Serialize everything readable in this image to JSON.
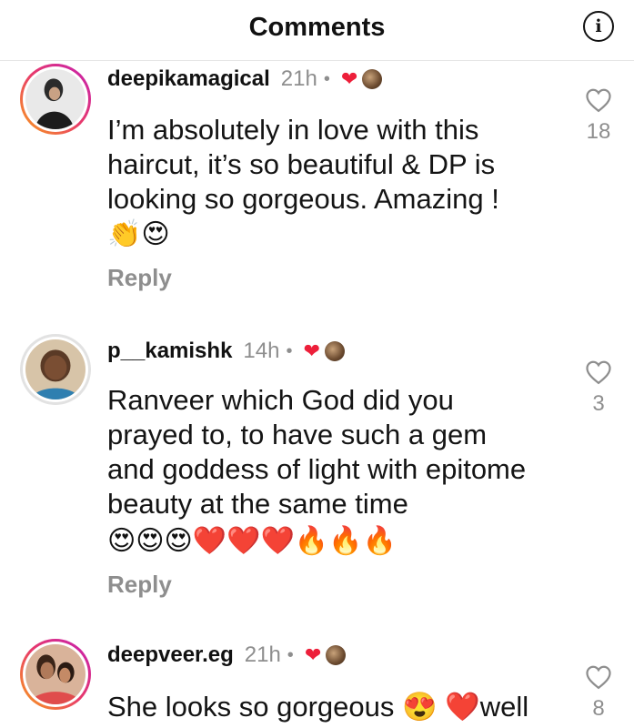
{
  "header": {
    "title": "Comments",
    "info_icon": "i"
  },
  "comments": [
    {
      "username": "deepikamagical",
      "time": "21h",
      "dot": "•",
      "liked_by_author": "❤",
      "text": "I’m absolutely in love with this haircut, it’s so beautiful & DP is looking so gorgeous. Amazing !",
      "emojis": "👏😍",
      "reply_label": "Reply",
      "likes": "18"
    },
    {
      "username": "p__kamishk",
      "time": "14h",
      "dot": "•",
      "liked_by_author": "❤",
      "text": "Ranveer which God did you prayed to, to have such a gem and goddess of light with epitome beauty at the same time",
      "emojis": "😍😍😍❤️❤️❤️🔥🔥🔥",
      "reply_label": "Reply",
      "likes": "3"
    },
    {
      "username": "deepveer.eg",
      "time": "21h",
      "dot": "•",
      "liked_by_author": "❤",
      "text": "She looks so gorgeous 😍 ❤️well",
      "likes": "8"
    }
  ]
}
